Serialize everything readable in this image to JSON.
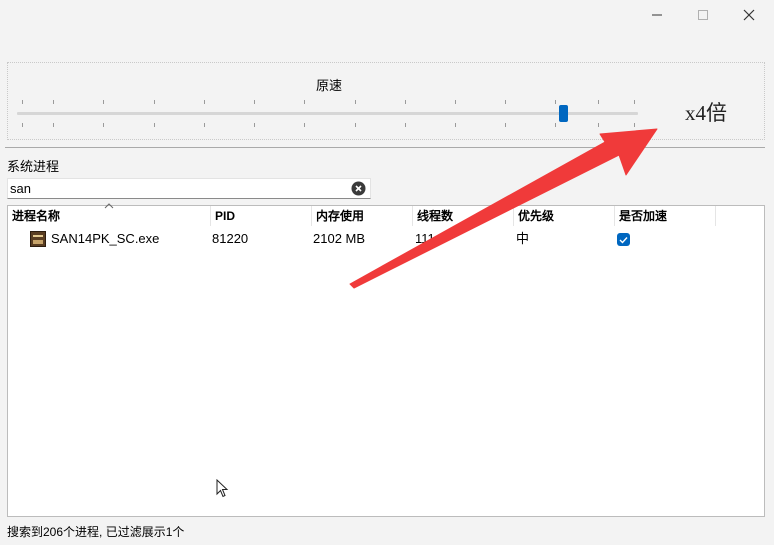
{
  "window": {
    "controls": [
      "minimize-icon",
      "maximize-icon",
      "close-icon"
    ]
  },
  "speed": {
    "caption": "原速",
    "multiplier_text": "x4倍",
    "slider_level": 0.88,
    "tick_count": 13
  },
  "process_section": {
    "title": "系统进程",
    "search_value": "san",
    "search_clear_icon": "clear-circle-icon"
  },
  "table": {
    "columns": [
      "进程名称",
      "PID",
      "内存使用",
      "线程数",
      "优先级",
      "是否加速"
    ],
    "sort_indicator": "sort-up-icon",
    "rows": [
      {
        "icon": "game-app-icon",
        "name": "SAN14PK_SC.exe",
        "pid": "81220",
        "memory": "2102 MB",
        "threads": "111",
        "priority": "中",
        "accelerated": true
      }
    ]
  },
  "status": {
    "text": "搜索到206个进程, 已过滤展示1个"
  },
  "overlay": {
    "arrow_color": "#f03a3a",
    "accent_color": "#0067c0"
  }
}
